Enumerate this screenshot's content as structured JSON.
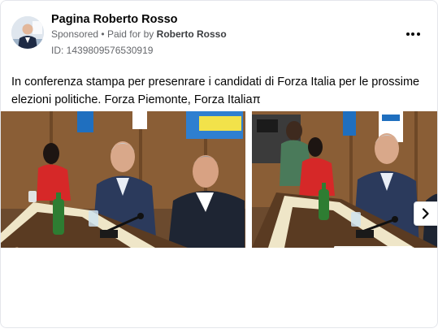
{
  "post": {
    "page_name": "Pagina Roberto Rosso",
    "sponsored_label": "Sponsored",
    "separator": "•",
    "paid_for_prefix": "Paid for by",
    "paid_for_name": "Roberto Rosso",
    "library_id": "ID: 1439809576530919",
    "text": "In conferenza stampa per presenrare i candidati di Forza Italia per le prossime elezioni politiche. Forza Piemonte, Forza Italiaπ"
  },
  "icons": {
    "more": "more-horizontal-icon",
    "next": "chevron-right-icon"
  },
  "images": [
    {
      "name": "press-conference-photo-1"
    },
    {
      "name": "press-conference-photo-2"
    }
  ],
  "colors": {
    "text_primary": "#050505",
    "text_secondary": "#65676b",
    "border": "#e4e6eb",
    "bottle_green": "#2e7d32"
  }
}
